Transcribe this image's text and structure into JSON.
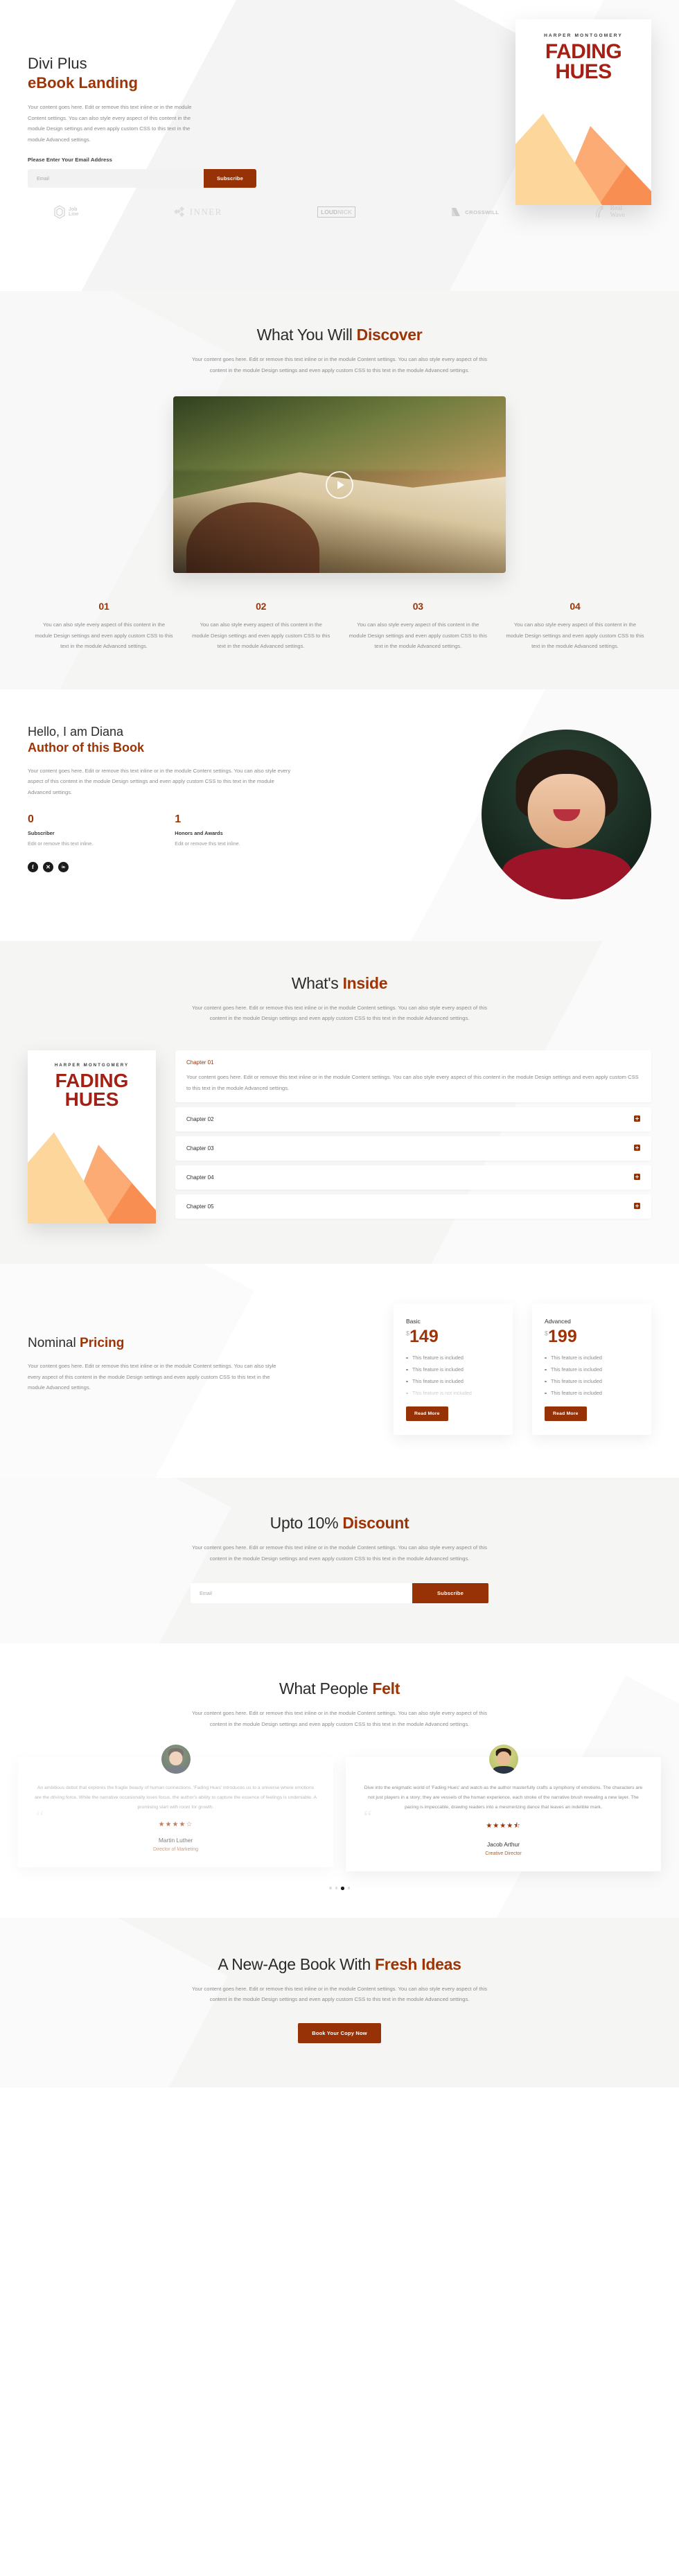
{
  "hero": {
    "title_line1": "Divi Plus",
    "title_line2": "eBook Landing",
    "paragraph": "Your content goes here. Edit or remove this text inline or in the module Content settings. You can also style every aspect of this content in the module Design settings and even apply custom CSS to this text in the module Advanced settings.",
    "form_label": "Please Enter Your Email Address",
    "email_placeholder": "Email",
    "email_value": "",
    "subscribe_label": "Subscribe"
  },
  "book": {
    "author": "HARPER MONTGOMERY",
    "title_line1": "FADING",
    "title_line2": "HUES"
  },
  "logos": [
    {
      "name": "job-line",
      "text_line1": "Job",
      "text_line2": "Line"
    },
    {
      "name": "inner",
      "text": "INNER"
    },
    {
      "name": "loudnick",
      "text_bold": "LOUD",
      "text_light": "NICK"
    },
    {
      "name": "crosswill",
      "text": "CROSSWILL"
    },
    {
      "name": "real-wave",
      "text_line1": "Real",
      "text_line2": "Wave"
    }
  ],
  "discover": {
    "title_dark": "What You Will ",
    "title_accent": "Discover",
    "subtitle": "Your content goes here. Edit or remove this text inline or in the module Content settings. You can also style every aspect of this content in the module Design settings and even apply custom CSS to this text in the module Advanced settings.",
    "features": [
      {
        "number": "01",
        "text": "You can also style every aspect of this content in the module Design settings and even apply custom CSS to this text in the module Advanced settings."
      },
      {
        "number": "02",
        "text": "You can also style every aspect of this content in the module Design settings and even apply custom CSS to this text in the module Advanced settings."
      },
      {
        "number": "03",
        "text": "You can also style every aspect of this content in the module Design settings and even apply custom CSS to this text in the module Advanced settings."
      },
      {
        "number": "04",
        "text": "You can also style every aspect of this content in the module Design settings and even apply custom CSS to this text in the module Advanced settings."
      }
    ]
  },
  "author": {
    "title_line1": "Hello, I am Diana",
    "title_line2": "Author of this Book",
    "paragraph": "Your content goes here. Edit or remove this text inline or in the module Content settings. You can also style every aspect of this content in the module Design settings and even apply custom CSS to this text in the module Advanced settings.",
    "stats": [
      {
        "number": "0",
        "label": "Subscriber",
        "sub": "Edit or remove this text inline."
      },
      {
        "number": "1",
        "label": "Honors and Awards",
        "sub": "Edit or remove this text inline."
      }
    ],
    "socials": [
      {
        "name": "facebook-icon",
        "glyph": "f"
      },
      {
        "name": "x-twitter-icon",
        "glyph": "✕"
      },
      {
        "name": "linkedin-icon",
        "glyph": "in"
      }
    ]
  },
  "inside": {
    "title_dark": "What's ",
    "title_accent": "Inside",
    "subtitle": "Your content goes here. Edit or remove this text inline or in the module Content settings. You can also style every aspect of this content in the module Design settings and even apply custom CSS to this text in the module Advanced settings.",
    "chapters": [
      {
        "title": "Chapter 01",
        "open": true,
        "body": "Your content goes here. Edit or remove this text inline or in the module Content settings. You can also style every aspect of this content in the module Design settings and even apply custom CSS to this text in the module Advanced settings."
      },
      {
        "title": "Chapter 02",
        "open": false,
        "body": ""
      },
      {
        "title": "Chapter 03",
        "open": false,
        "body": ""
      },
      {
        "title": "Chapter 04",
        "open": false,
        "body": ""
      },
      {
        "title": "Chapter 05",
        "open": false,
        "body": ""
      }
    ]
  },
  "pricing": {
    "title_dark": "Nominal ",
    "title_accent": "Pricing",
    "paragraph": "Your content goes here. Edit or remove this text inline or in the module Content settings. You can also style every aspect of this content in the module Design settings and even apply custom CSS to this text in the module Advanced settings.",
    "plans": [
      {
        "name": "Basic",
        "currency": "$",
        "price": "149",
        "features": [
          {
            "text": "This feature is included",
            "included": true
          },
          {
            "text": "This feature is included",
            "included": true
          },
          {
            "text": "This feature is included",
            "included": true
          },
          {
            "text": "This feature is not included",
            "included": false
          }
        ],
        "button": "Read More"
      },
      {
        "name": "Advanced",
        "currency": "$",
        "price": "199",
        "features": [
          {
            "text": "This feature is included",
            "included": true
          },
          {
            "text": "This feature is included",
            "included": true
          },
          {
            "text": "This feature is included",
            "included": true
          },
          {
            "text": "This feature is included",
            "included": true
          }
        ],
        "button": "Read More"
      }
    ]
  },
  "discount": {
    "title_dark": "Upto 10% ",
    "title_accent": "Discount",
    "subtitle": "Your content goes here. Edit or remove this text inline or in the module Content settings. You can also style every aspect of this content in the module Design settings and even apply custom CSS to this text in the module Advanced settings.",
    "email_placeholder": "Email",
    "email_value": "",
    "subscribe_label": "Subscribe"
  },
  "testimonials": {
    "title_dark": "What People ",
    "title_accent": "Felt",
    "subtitle": "Your content goes here. Edit or remove this text inline or in the module Content settings. You can also style every aspect of this content in the module Design settings and even apply custom CSS to this text in the module Advanced settings.",
    "items": [
      {
        "text": "An ambitious debut that explores the fragile beauty of human connections. 'Fading Hues' introduces us to a universe where emotions are the driving force. While the narrative occasionally loses focus, the author's ability to capture the essence of feelings is undeniable. A promising start with room for growth.",
        "rating": "4",
        "rating_display": "★★★★☆",
        "name": "Martin Luther",
        "role": "Director of Marketing"
      },
      {
        "text": "Dive into the enigmatic world of 'Fading Hues' and watch as the author masterfully crafts a symphony of emotions. The characters are not just players in a story; they are vessels of the human experience, each stroke of the narrative brush revealing a new layer. The pacing is impeccable, drawing readers into a mesmerizing dance that leaves an indelible mark.",
        "rating": "4.5",
        "rating_display": "★★★★⯪",
        "name": "Jacob Arthur",
        "role": "Creative Director"
      }
    ],
    "dots_count": 4,
    "active_dot": 2
  },
  "cta": {
    "title_dark": "A New-Age Book With ",
    "title_accent": "Fresh Ideas",
    "subtitle": "Your content goes here. Edit or remove this text inline or in the module Content settings. You can also style every aspect of this content in the module Design settings and even apply custom CSS to this text in the module Advanced settings.",
    "button": "Book Your Copy Now"
  },
  "colors": {
    "accent": "#9c3406",
    "button": "#963206",
    "book_red": "#a41f14",
    "section_bg": "#f5f5f4"
  }
}
